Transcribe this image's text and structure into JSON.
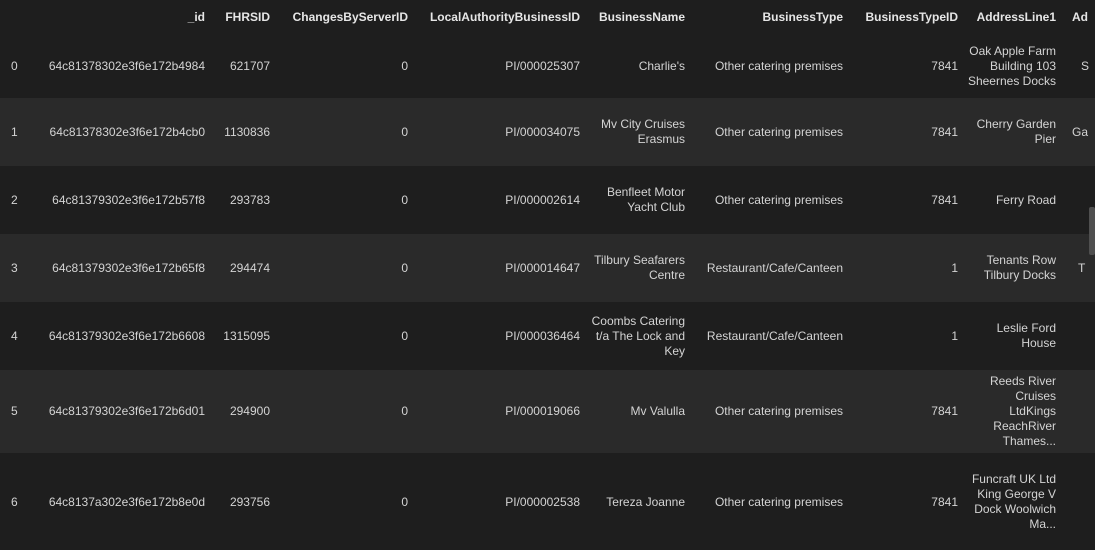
{
  "dataframe": {
    "columns": [
      "",
      "_id",
      "FHRSID",
      "ChangesByServerID",
      "LocalAuthorityBusinessID",
      "BusinessName",
      "BusinessType",
      "BusinessTypeID",
      "AddressLine1",
      "Ad"
    ],
    "rows": [
      [
        "0",
        "64c81378302e3f6e172b4984",
        "621707",
        "0",
        "PI/000025307",
        "Charlie's",
        "Other catering premises",
        "7841",
        "Oak Apple Farm Building 103 Sheernes Docks",
        "S"
      ],
      [
        "1",
        "64c81378302e3f6e172b4cb0",
        "1130836",
        "0",
        "PI/000034075",
        "Mv City Cruises Erasmus",
        "Other catering premises",
        "7841",
        "Cherry Garden Pier",
        "Ga"
      ],
      [
        "2",
        "64c81379302e3f6e172b57f8",
        "293783",
        "0",
        "PI/000002614",
        "Benfleet Motor Yacht Club",
        "Other catering premises",
        "7841",
        "Ferry Road",
        ""
      ],
      [
        "3",
        "64c81379302e3f6e172b65f8",
        "294474",
        "0",
        "PI/000014647",
        "Tilbury Seafarers Centre",
        "Restaurant/Cafe/Canteen",
        "1",
        "Tenants Row Tilbury Docks",
        "T"
      ],
      [
        "4",
        "64c81379302e3f6e172b6608",
        "1315095",
        "0",
        "PI/000036464",
        "Coombs Catering t/a The Lock and Key",
        "Restaurant/Cafe/Canteen",
        "1",
        "Leslie Ford House",
        ""
      ],
      [
        "5",
        "64c81379302e3f6e172b6d01",
        "294900",
        "0",
        "PI/000019066",
        "Mv Valulla",
        "Other catering premises",
        "7841",
        "Reeds River Cruises LtdKings ReachRiver Thames...",
        ""
      ],
      [
        "6",
        "64c8137a302e3f6e172b8e0d",
        "293756",
        "0",
        "PI/000002538",
        "Tereza Joanne",
        "Other catering premises",
        "7841",
        "Funcraft UK Ltd King George V Dock Woolwich Ma...",
        ""
      ]
    ]
  }
}
